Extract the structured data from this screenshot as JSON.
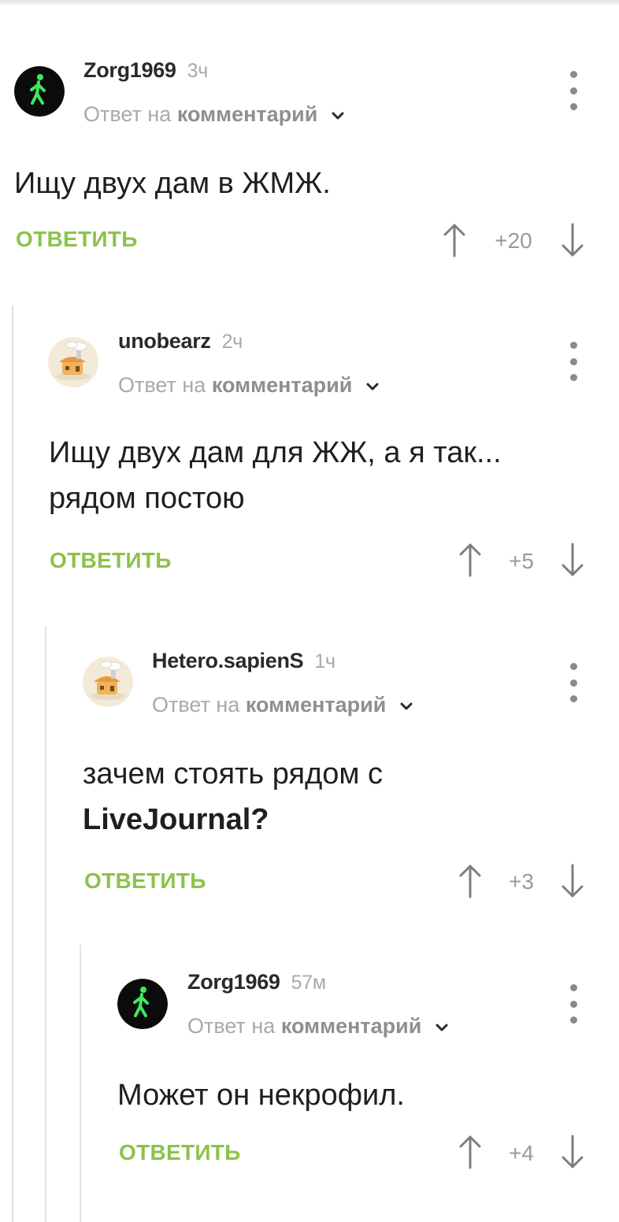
{
  "comments": [
    {
      "author": "Zorg1969",
      "time": "3ч",
      "reply_prefix": "Ответ на",
      "reply_link": "комментарий",
      "text": "Ищу двух дам в ЖМЖ.",
      "reply_label": "ОТВЕТИТЬ",
      "score": "+20",
      "avatar": "walking-man-avatar"
    },
    {
      "author": "unobearz",
      "time": "2ч",
      "reply_prefix": "Ответ на",
      "reply_link": "комментарий",
      "text_line1": "Ищу двух дам для ЖЖ, а я так...",
      "text_line2": "рядом постою",
      "reply_label": "ОТВЕТИТЬ",
      "score": "+5",
      "avatar": "house-avatar"
    },
    {
      "author": "Hetero.sapienS",
      "time": "1ч",
      "reply_prefix": "Ответ на",
      "reply_link": "комментарий",
      "text_line1": "зачем стоять рядом с",
      "text_bold": "LiveJournal?",
      "reply_label": "ОТВЕТИТЬ",
      "score": "+3",
      "avatar": "house-avatar"
    },
    {
      "author": "Zorg1969",
      "time": "57м",
      "reply_prefix": "Ответ на",
      "reply_link": "комментарий",
      "text": "Может он некрофил.",
      "reply_label": "ОТВЕТИТЬ",
      "score": "+4",
      "avatar": "walking-man-avatar"
    }
  ],
  "colors": {
    "accent_green": "#8bc34a",
    "muted_text": "#a9a9a9",
    "thread_line": "#e2e2e2"
  },
  "icons": [
    "menu-dots-icon",
    "chevron-down-icon",
    "arrow-up-icon",
    "arrow-down-icon"
  ]
}
